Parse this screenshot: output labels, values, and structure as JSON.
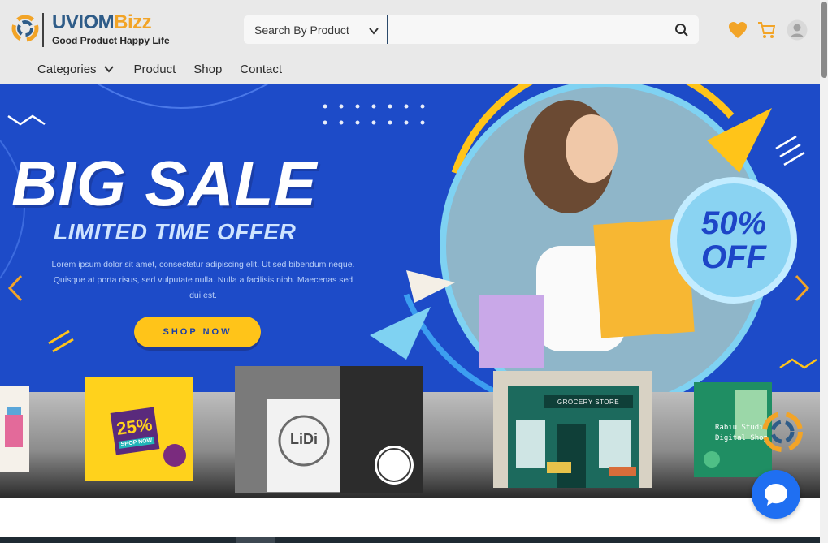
{
  "header": {
    "brand": {
      "name_part1": "UVIOM",
      "name_part2": "Bizz",
      "tagline": "Good Product Happy Life"
    },
    "search": {
      "category_label": "Search By Product",
      "placeholder": "",
      "icon": "search-icon"
    },
    "icons": [
      "heart-icon",
      "cart-icon",
      "user-avatar-icon"
    ]
  },
  "nav": {
    "categories_label": "Categories",
    "items": [
      "Product",
      "Shop",
      "Contact"
    ]
  },
  "hero": {
    "title": "BIG SALE",
    "subtitle": "LIMITED TIME OFFER",
    "body": "Lorem ipsum dolor sit amet, consectetur adipiscing elit. Ut sed bibendum neque. Quisque at porta risus, sed vulputate nulla. Nulla a facilisis nibh. Maecenas sed dui est.",
    "button": "SHOP NOW",
    "badge_line1": "50%",
    "badge_line2": "OFF"
  },
  "promo_cards": {
    "card_b": {
      "percent": "25%",
      "sub": "SHOP NOW"
    },
    "card_c": {
      "brand": "LiDi"
    },
    "card_d": {
      "sign": "GROCERY STORE"
    },
    "card_e": {
      "line1": "RabiulStudio",
      "line2": "Digital Shop"
    }
  },
  "colors": {
    "brand_blue": "#2f5c88",
    "brand_orange": "#f2a427",
    "hero_blue": "#1f4fd0",
    "chat_blue": "#1f6ff2"
  }
}
